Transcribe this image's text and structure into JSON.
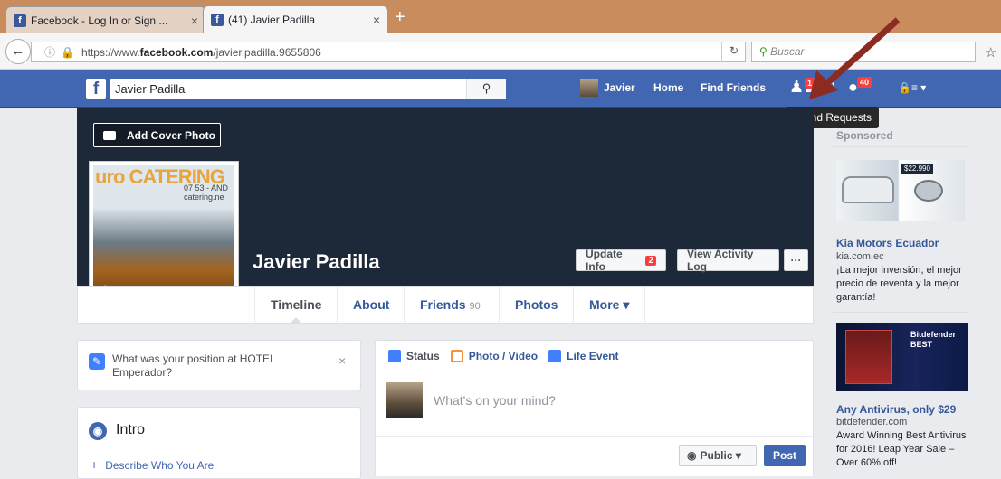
{
  "browser": {
    "tab1": {
      "title": "Facebook - Log In or Sign ...",
      "close": "×"
    },
    "tab2": {
      "title": "(41) Javier Padilla",
      "close": "×"
    },
    "new_tab": "+",
    "url_prefix": "https://www.",
    "url_domain": "facebook.com",
    "url_path": "/javier.padilla.9655806",
    "search_placeholder": "Buscar",
    "icons": [
      "back-icon",
      "info-icon",
      "lock-icon",
      "reload-icon",
      "star-icon"
    ]
  },
  "fb_bar": {
    "logo": "f",
    "search_value": "Javier Padilla",
    "search_icon": "search-icon",
    "user_name": "Javier",
    "home": "Home",
    "find_friends": "Find Friends",
    "friend_requests_count": "1",
    "notifications_count": "40"
  },
  "tooltip": "Friend Requests",
  "profile": {
    "add_cover_photo": "Add Cover Photo",
    "name": "Javier Padilla",
    "pic_sign": "uro CATERING",
    "pic_sign2": "07 53 - AND catering.ne",
    "update_info": "Update Info",
    "update_info_badge": "2",
    "view_activity_log": "View Activity Log",
    "more_dots": "···"
  },
  "tabs": {
    "timeline": "Timeline",
    "about": "About",
    "friends": "Friends",
    "friends_count": "90",
    "photos": "Photos",
    "more": "More ▾"
  },
  "left": {
    "position_prompt": "What was your position at HOTEL Emperador?",
    "close": "×",
    "intro_title": "Intro",
    "describe": "Describe Who You Are"
  },
  "composer": {
    "status": "Status",
    "photo_video": "Photo / Video",
    "life_event": "Life Event",
    "placeholder": "What's on your mind?",
    "public": "Public ▾",
    "post": "Post"
  },
  "sidebar": {
    "sponsored": "Sponsored",
    "ad1": {
      "price_tag": "$22.990",
      "title": "Kia Motors Ecuador",
      "url": "kia.com.ec",
      "body": "¡La mejor inversión, el mejor precio de reventa y la mejor garantía!"
    },
    "ad2": {
      "img_text": "Bitdefender BEST",
      "title": "Any Antivirus, only $29",
      "url": "bitdefender.com",
      "body": "Award Winning Best Antivirus for 2016! Leap Year Sale – Over 60% off!"
    }
  },
  "colors": {
    "fb_blue": "#4267b2",
    "badge_red": "#fa3e3e",
    "cover_bg": "#1d2838",
    "arrow": "#8b2b22"
  }
}
